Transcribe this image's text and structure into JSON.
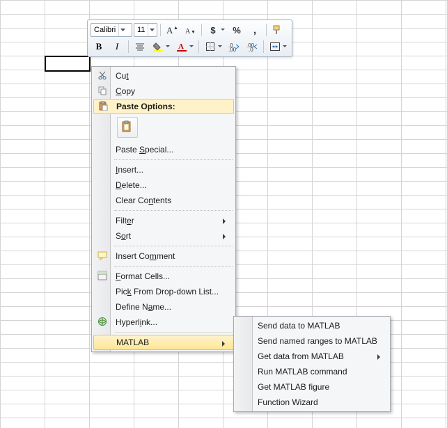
{
  "toolbar": {
    "font_name": "Calibri",
    "font_size": "11"
  },
  "context_menu": {
    "cut": "Cut",
    "copy": "Copy",
    "paste_options": "Paste Options:",
    "paste_special": "Paste Special...",
    "insert": "Insert...",
    "delete": "Delete...",
    "clear_contents": "Clear Contents",
    "filter": "Filter",
    "sort": "Sort",
    "insert_comment": "Insert Comment",
    "format_cells": "Format Cells...",
    "pick_from_list": "Pick From Drop-down List...",
    "define_name": "Define Name...",
    "hyperlink": "Hyperlink...",
    "matlab": "MATLAB"
  },
  "matlab_submenu": {
    "send_data": "Send data to MATLAB",
    "send_named_ranges": "Send named ranges to MATLAB",
    "get_data": "Get data from MATLAB",
    "run_command": "Run MATLAB command",
    "get_figure": "Get MATLAB figure",
    "function_wizard": "Function Wizard"
  }
}
